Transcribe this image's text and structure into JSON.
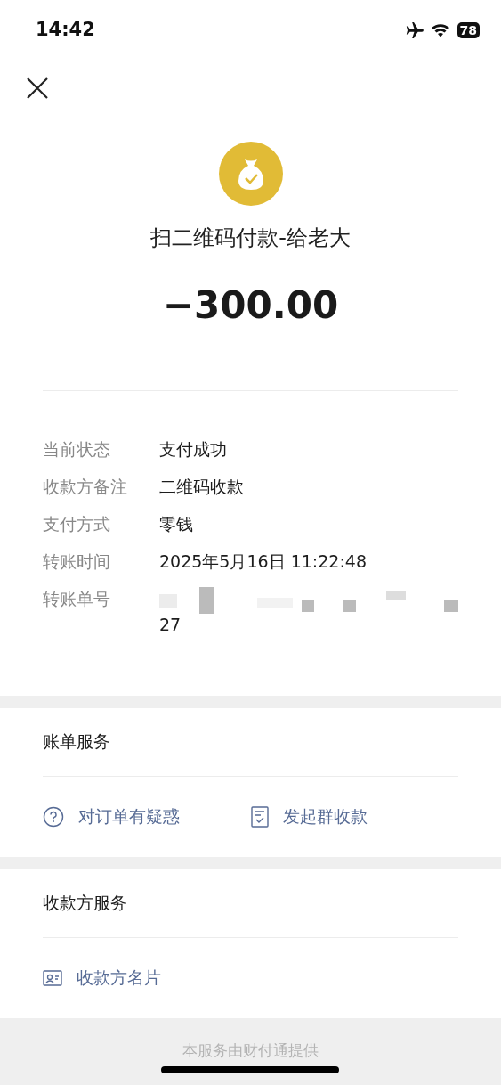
{
  "status_bar": {
    "time": "14:42",
    "battery": "78"
  },
  "merchant": {
    "title": "扫二维码付款-给老大",
    "amount": "−300.00"
  },
  "details": [
    {
      "label": "当前状态",
      "value": "支付成功"
    },
    {
      "label": "收款方备注",
      "value": "二维码收款"
    },
    {
      "label": "支付方式",
      "value": "零钱"
    },
    {
      "label": "转账时间",
      "value": "2025年5月16日 11:22:48"
    },
    {
      "label": "转账单号",
      "value": "27",
      "kind": "redacted"
    }
  ],
  "sections": [
    {
      "title": "账单服务",
      "actions": [
        {
          "label": "对订单有疑惑",
          "kind": "question"
        },
        {
          "label": "发起群收款",
          "kind": "checklist"
        }
      ]
    },
    {
      "title": "收款方服务",
      "actions": [
        {
          "label": "收款方名片",
          "kind": "card"
        }
      ]
    }
  ],
  "footer": "本服务由财付通提供"
}
